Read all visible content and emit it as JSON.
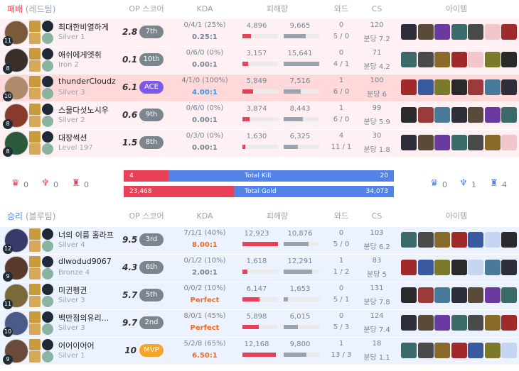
{
  "loss_header": {
    "result": "패배",
    "team": "(레드팀)",
    "op": "OP 스코어",
    "kda": "KDA",
    "dmg": "피해량",
    "ward": "와드",
    "cs": "CS",
    "items": "아이템"
  },
  "win_header": {
    "result": "승리",
    "team": "(블루팀)",
    "op": "OP 스코어",
    "kda": "KDA",
    "dmg": "피해량",
    "ward": "와드",
    "cs": "CS",
    "items": "아이템"
  },
  "loss_players": [
    {
      "name": "최대한비열하게",
      "tier": "Silver 1",
      "level": "11",
      "op": "2.8",
      "rank": "7th",
      "kda1": "0/4/1 (25%)",
      "kda2": "0.25:1",
      "dealt": "4,896",
      "taken": "9,665",
      "dealt_pct": 0.24,
      "taken_pct": 0.62,
      "ward1": "0",
      "ward2": "5 / 0",
      "cs1": "120",
      "cs2": "분당 7.2"
    },
    {
      "name": "애쉬에게엣취",
      "tier": "Iron 2",
      "level": "8",
      "op": "0.1",
      "rank": "10th",
      "kda1": "0/6/0 (0%)",
      "kda2": "0.00:1",
      "dealt": "3,157",
      "taken": "15,641",
      "dealt_pct": 0.16,
      "taken_pct": 1.0,
      "ward1": "0",
      "ward2": "4 / 1",
      "cs1": "71",
      "cs2": "분당 4.2"
    },
    {
      "name": "thunderCloudz",
      "tier": "Silver 3",
      "level": "10",
      "op": "6.1",
      "rank": "ACE",
      "kda1": "4/1/0 (100%)",
      "kda2": "4.00:1",
      "dealt": "5,849",
      "taken": "7,516",
      "dealt_pct": 0.29,
      "taken_pct": 0.48,
      "ward1": "1",
      "ward2": "6 / 0",
      "cs1": "100",
      "cs2": "분당 6"
    },
    {
      "name": "스물다섯노시우",
      "tier": "Silver 2",
      "level": "8",
      "op": "0.6",
      "rank": "9th",
      "kda1": "0/6/0 (0%)",
      "kda2": "0.00:1",
      "dealt": "3,874",
      "taken": "8,443",
      "dealt_pct": 0.19,
      "taken_pct": 0.54,
      "ward1": "1",
      "ward2": "6 / 0",
      "cs1": "99",
      "cs2": "분당 5.9"
    },
    {
      "name": "대장썩션",
      "tier": "Level 197",
      "level": "8",
      "op": "1.5",
      "rank": "8th",
      "kda1": "0/3/0 (0%)",
      "kda2": "0.00:1",
      "dealt": "1,630",
      "taken": "6,325",
      "dealt_pct": 0.08,
      "taken_pct": 0.4,
      "ward1": "4",
      "ward2": "11 / 1",
      "cs1": "30",
      "cs2": "분당 1.8"
    }
  ],
  "summary": {
    "kills_red": "4",
    "kills_label": "Total Kill",
    "kills_blue": "20",
    "kills_red_pct": 0.167,
    "gold_red": "23,468",
    "gold_label": "Total Gold",
    "gold_blue": "34,073",
    "gold_red_pct": 0.408,
    "red_obj": [
      "0",
      "0",
      "0"
    ],
    "blue_obj": [
      "0",
      "1",
      "4"
    ]
  },
  "win_players": [
    {
      "name": "너의 이름 홀라프",
      "tier": "Silver 4",
      "level": "12",
      "op": "9.5",
      "rank": "3rd",
      "kda1": "7/1/1 (40%)",
      "kda2": "8.00:1",
      "dealt": "12,923",
      "taken": "10,876",
      "dealt_pct": 1.0,
      "taken_pct": 0.7,
      "ward1": "0",
      "ward2": "5 / 0",
      "cs1": "103",
      "cs2": "분당 6.2"
    },
    {
      "name": "dlwodud9067",
      "tier": "Bronze 4",
      "level": "9",
      "op": "4.3",
      "rank": "6th",
      "kda1": "0/1/2 (10%)",
      "kda2": "2.00:1",
      "dealt": "1,618",
      "taken": "12,291",
      "dealt_pct": 0.13,
      "taken_pct": 0.79,
      "ward1": "1",
      "ward2": "1 / 2",
      "cs1": "83",
      "cs2": "분당 5"
    },
    {
      "name": "미귄펭귄",
      "tier": "Silver 3",
      "level": "11",
      "op": "5.7",
      "rank": "5th",
      "kda1": "0/0/2 (10%)",
      "kda2": "Perfect",
      "dealt": "6,147",
      "taken": "1,653",
      "dealt_pct": 0.48,
      "taken_pct": 0.11,
      "ward1": "0",
      "ward2": "5 / 1",
      "cs1": "131",
      "cs2": "분당 7.8"
    },
    {
      "name": "백만점의유리...",
      "tier": "Silver 3",
      "level": "10",
      "op": "9.7",
      "rank": "2nd",
      "kda1": "8/0/1 (45%)",
      "kda2": "Perfect",
      "dealt": "5,898",
      "taken": "6,015",
      "dealt_pct": 0.46,
      "taken_pct": 0.39,
      "ward1": "0",
      "ward2": "5 / 3",
      "cs1": "124",
      "cs2": "분당 7.4"
    },
    {
      "name": "어어이어어",
      "tier": "Silver 1",
      "level": "9",
      "op": "10",
      "rank": "MVP",
      "kda1": "5/2/8 (65%)",
      "kda2": "6.50:1",
      "dealt": "12,168",
      "taken": "9,800",
      "dealt_pct": 0.94,
      "taken_pct": 0.63,
      "ward1": "1",
      "ward2": "13 / 3",
      "cs1": "18",
      "cs2": "분당 1.1"
    }
  ]
}
